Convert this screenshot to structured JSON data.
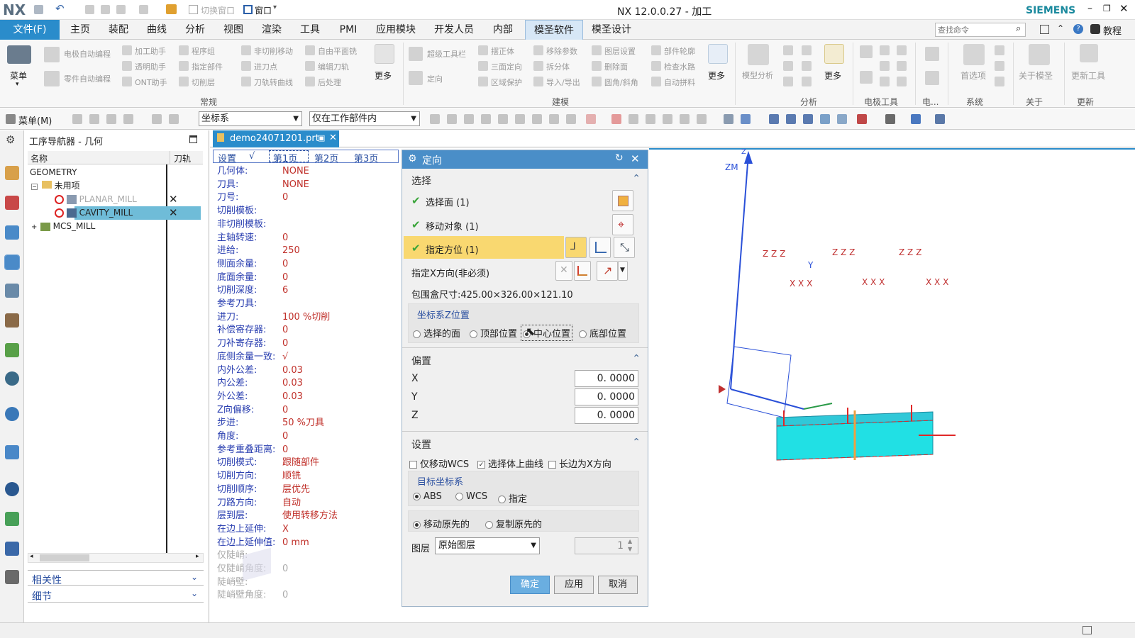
{
  "titlebar": {
    "logo": "NX",
    "switch_window": "切换窗口",
    "window_menu": "窗口",
    "title": "NX 12.0.0.27 - 加工",
    "brand": "SIEMENS"
  },
  "menubar": {
    "file": "文件(F)",
    "items": [
      "主页",
      "装配",
      "曲线",
      "分析",
      "视图",
      "渲染",
      "工具",
      "PMI",
      "应用模块",
      "开发人员",
      "内部",
      "模圣软件",
      "模圣设计"
    ],
    "active": "模圣软件",
    "search_placeholder": "查找命令",
    "tutorial": "教程"
  },
  "ribbon": {
    "menu_btn": "菜单",
    "group_changgui": {
      "label": "常规",
      "items": [
        "电极自动编程",
        "零件自动编程",
        "加工助手",
        "透明助手",
        "ONT助手",
        "程序组",
        "指定部件",
        "切削层",
        "非切削移动",
        "进刀点",
        "刀轨转曲线",
        "自由平面铣",
        "编辑刀轨",
        "后处理"
      ],
      "more": "更多"
    },
    "group_jianmo": {
      "label": "建模",
      "items": [
        "超级工具栏",
        "定向",
        "摆正体",
        "三面定向",
        "区域保护",
        "移除参数",
        "拆分体",
        "导入/导出",
        "图层设置",
        "删除面",
        "圆角/斜角",
        "部件轮廓",
        "检查水路",
        "自动拼料"
      ],
      "more": "更多"
    },
    "group_fenxi": {
      "label": "分析",
      "items": [
        "模型分析"
      ],
      "more": "更多"
    },
    "group_dianji": {
      "label": "电极工具"
    },
    "group_dian2": {
      "label": "电..."
    },
    "group_xitong": {
      "label": "系统",
      "items": [
        "首选项"
      ]
    },
    "group_guanyu": {
      "label": "关于",
      "items": [
        "关于模圣"
      ]
    },
    "group_gengxin": {
      "label": "更新",
      "items": [
        "更新工具"
      ]
    }
  },
  "toolbar2": {
    "menu": "菜单(M)",
    "filter1": "坐标系",
    "filter2": "仅在工作部件内"
  },
  "navigator": {
    "title": "工序导航器 - 几何",
    "col_name": "名称",
    "col_path": "刀轨",
    "rows": [
      {
        "label": "GEOMETRY"
      },
      {
        "label": "未用项"
      },
      {
        "label": "PLANAR_MILL",
        "mark": "✕"
      },
      {
        "label": "CAVITY_MILL",
        "mark": "✕"
      },
      {
        "label": "MCS_MILL"
      }
    ],
    "section_related": "相关性",
    "section_detail": "细节"
  },
  "tab": {
    "filename": "demo24071201.prt"
  },
  "info": {
    "tabs": [
      "设置",
      "√",
      "第1页",
      "第2页",
      "第3页"
    ],
    "rows": [
      {
        "label": "几何体:",
        "value": "NONE"
      },
      {
        "label": "刀具:",
        "value": "NONE"
      },
      {
        "label": "刀号:",
        "value": "0"
      },
      {
        "label": "切削模板:",
        "value": ""
      },
      {
        "label": "非切削模板:",
        "value": ""
      },
      {
        "label": "主轴转速:",
        "value": "0"
      },
      {
        "label": "进给:",
        "value": "250"
      },
      {
        "label": "侧面余量:",
        "value": "0"
      },
      {
        "label": "底面余量:",
        "value": "0"
      },
      {
        "label": "切削深度:",
        "value": "6"
      },
      {
        "label": "参考刀具:",
        "value": ""
      },
      {
        "label": "进刀:",
        "value": "100   %切削"
      },
      {
        "label": "补偿寄存器:",
        "value": "0"
      },
      {
        "label": "刀补寄存器:",
        "value": "0"
      },
      {
        "label": "底侧余量一致:",
        "value": "√"
      },
      {
        "label": "内外公差:",
        "value": "0.03"
      },
      {
        "label": "内公差:",
        "value": "0.03"
      },
      {
        "label": "外公差:",
        "value": "0.03"
      },
      {
        "label": "Z向偏移:",
        "value": "0"
      },
      {
        "label": "步进:",
        "value": "50    %刀具"
      },
      {
        "label": "角度:",
        "value": "0"
      },
      {
        "label": "参考重叠距离:",
        "value": "0"
      },
      {
        "label": "切削模式:",
        "value": "跟随部件"
      },
      {
        "label": "切削方向:",
        "value": "顺铣"
      },
      {
        "label": "切削顺序:",
        "value": "层优先"
      },
      {
        "label": "刀路方向:",
        "value": "自动"
      },
      {
        "label": "层到层:",
        "value": "使用转移方法"
      },
      {
        "label": "在边上延伸:",
        "value": "X"
      },
      {
        "label": "在边上延伸值:",
        "value": "0      mm"
      },
      {
        "label": "仅陡峭:",
        "value": ""
      },
      {
        "label": "仅陡峭角度:",
        "value": "0"
      },
      {
        "label": "陡峭壁:",
        "value": ""
      },
      {
        "label": "陡峭壁角度:",
        "value": "0"
      }
    ]
  },
  "dialog": {
    "title": "定向",
    "select": {
      "header": "选择",
      "select_face": "选择面 (1)",
      "move_object": "移动对象 (1)",
      "specify_orient": "指定方位 (1)",
      "specify_x": "指定X方向(非必须)",
      "bbox": "包围盒尺寸:425.00×326.00×121.10",
      "zpos_title": "坐标系Z位置",
      "zpos_options": [
        "选择的面",
        "顶部位置",
        "中心位置",
        "底部位置"
      ],
      "zpos_selected": "中心位置"
    },
    "offset": {
      "header": "偏置",
      "x_label": "X",
      "x_value": "0. 0000",
      "y_label": "Y",
      "y_value": "0. 0000",
      "z_label": "Z",
      "z_value": "0. 0000"
    },
    "settings": {
      "header": "设置",
      "opt_move_wcs": "仅移动WCS",
      "opt_select_curve": "选择体上曲线",
      "opt_long_edge": "长边为X方向",
      "target_title": "目标坐标系",
      "target_options": [
        "ABS",
        "WCS",
        "指定"
      ],
      "target_selected": "ABS",
      "move_options": [
        "移动原先的",
        "复制原先的"
      ],
      "move_selected": "移动原先的",
      "layer_label": "图层",
      "layer_value": "原始图层",
      "layer_num": "1"
    },
    "buttons": {
      "ok": "确定",
      "apply": "应用",
      "cancel": "取消"
    }
  },
  "viewport": {
    "zm": "ZM",
    "zzz": "Z Z Z",
    "xxx": "X X X",
    "y": "Y",
    "z": "Z"
  },
  "colors": {
    "accent": "#2a8ccb",
    "active_tab": "#d7e7f6",
    "highlight": "#f9d870",
    "part": "#21e0e4",
    "arrow": "#e02828"
  }
}
